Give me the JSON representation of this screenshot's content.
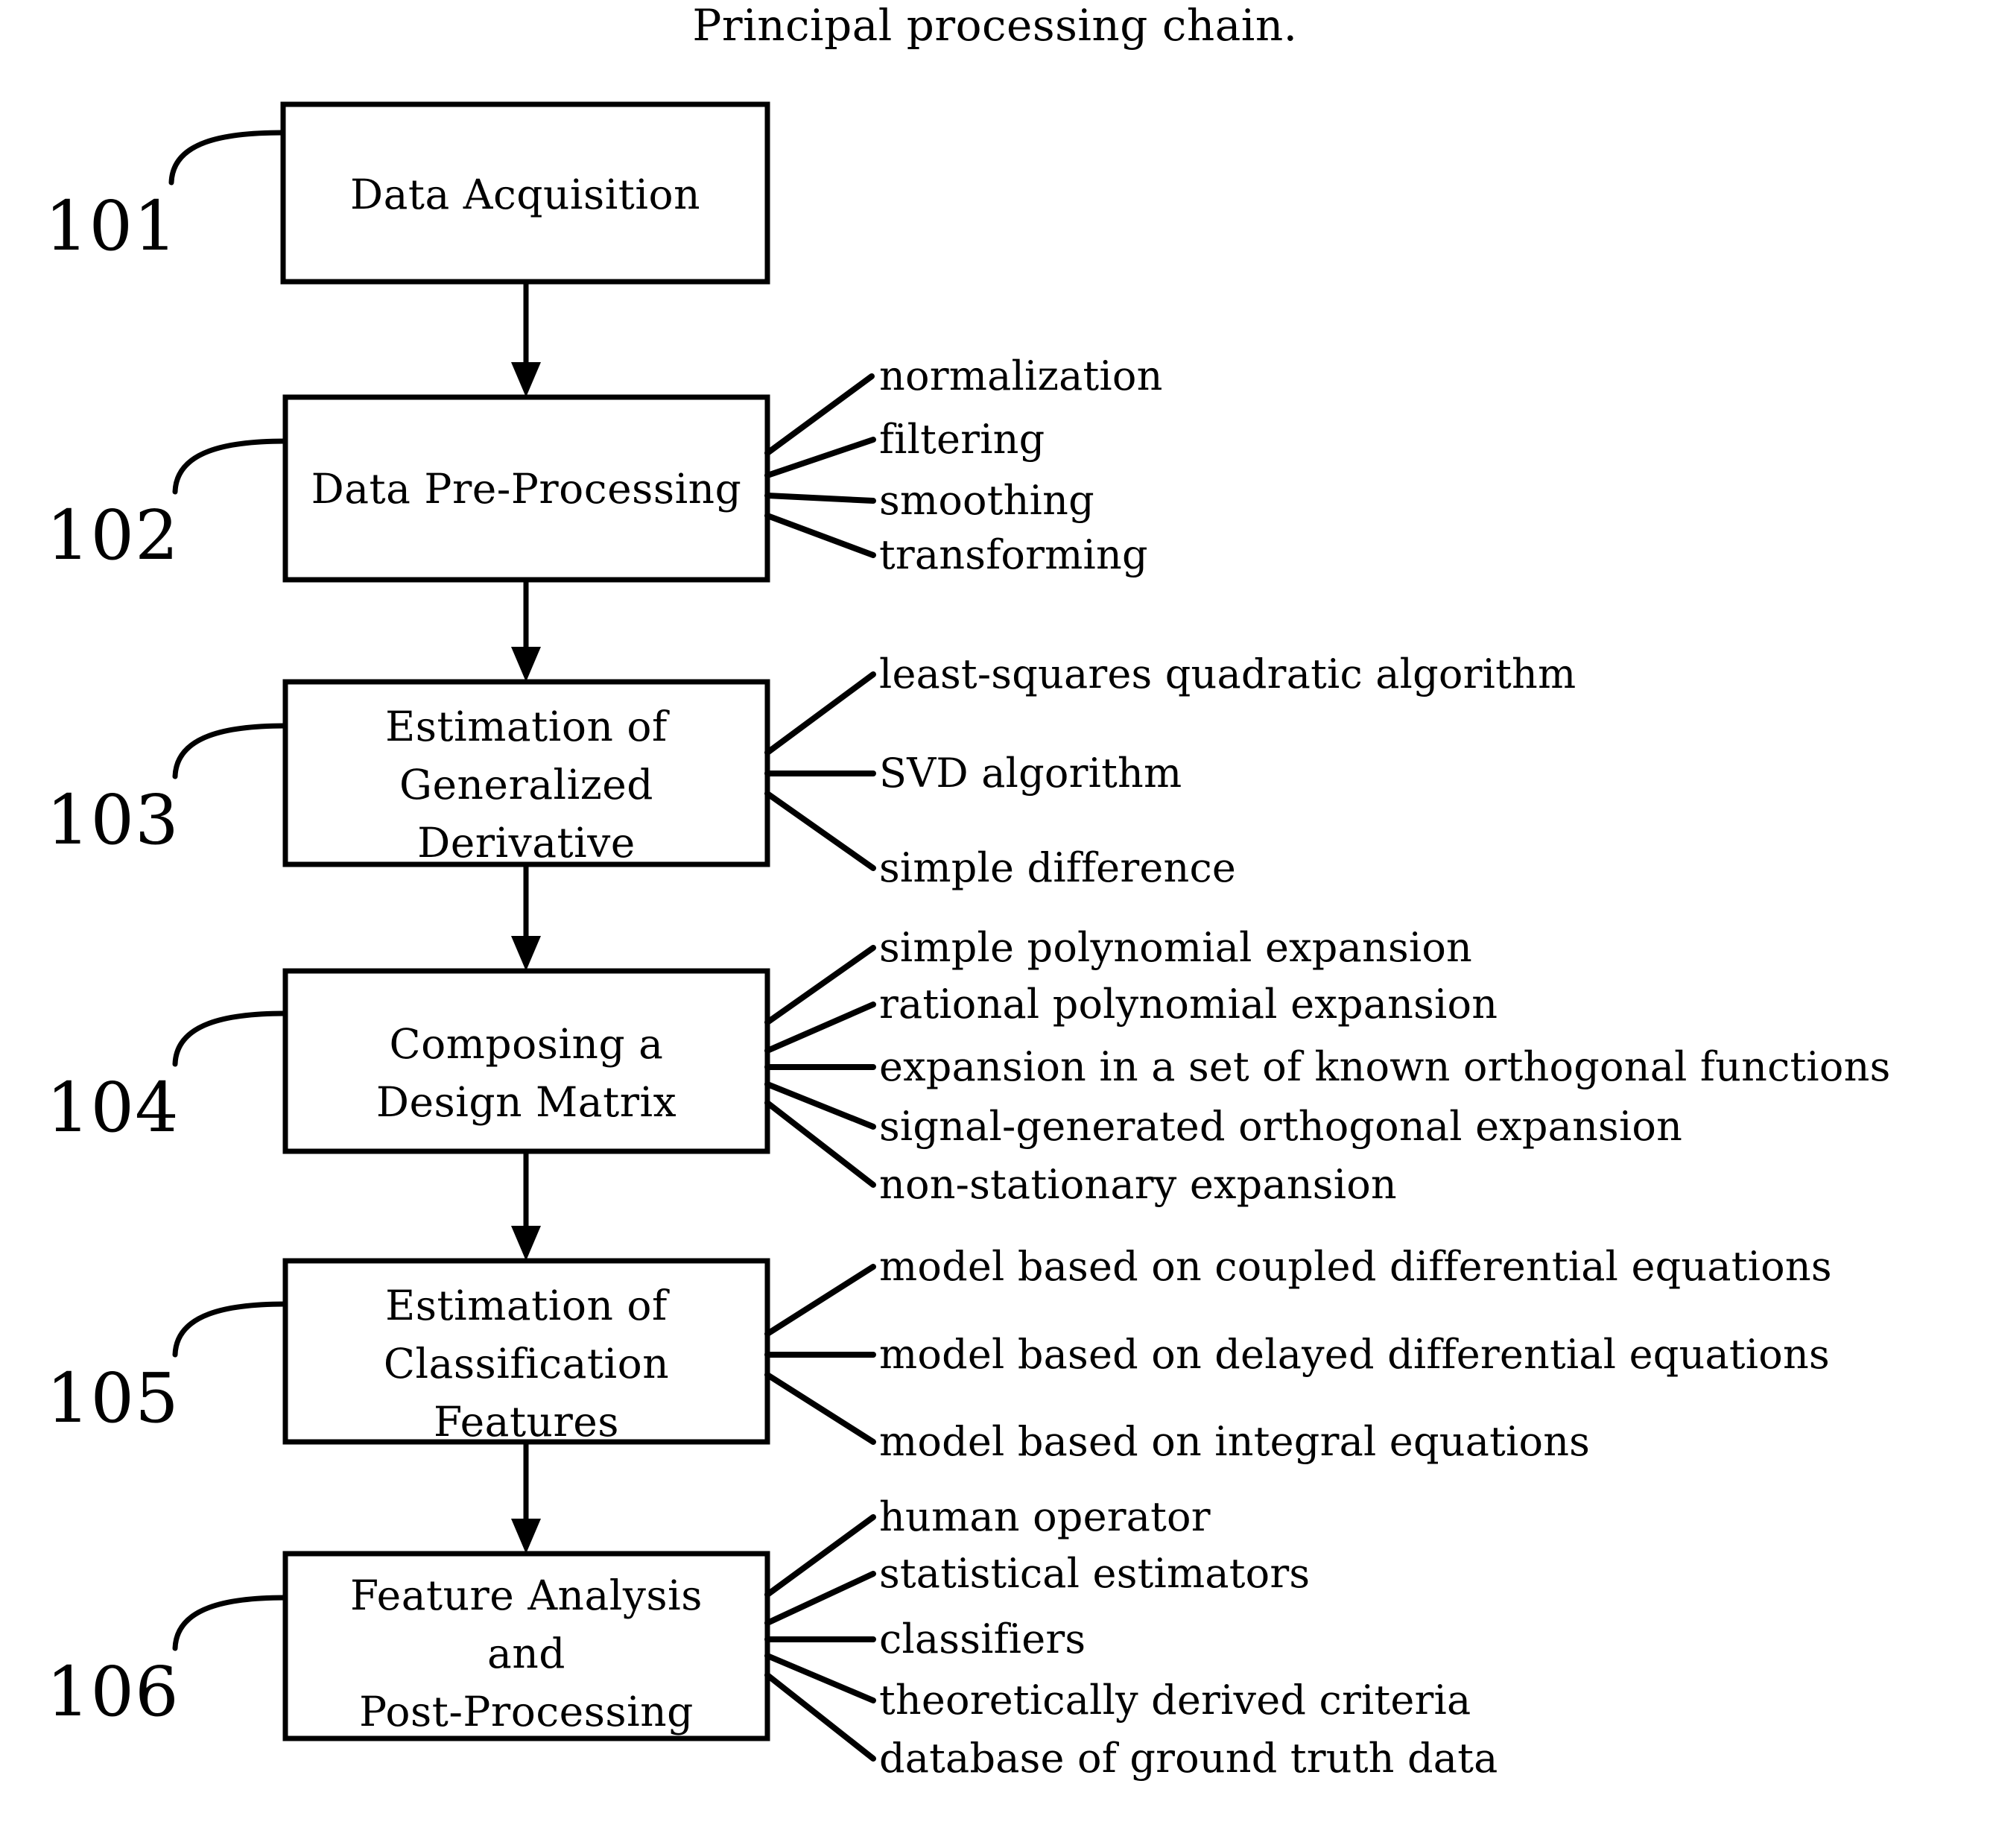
{
  "figure": {
    "title": "Principal processing chain."
  },
  "steps": [
    {
      "ref": "101",
      "label": "Data Acquisition",
      "annotations": []
    },
    {
      "ref": "102",
      "label": "Data Pre-Processing",
      "annotations": [
        "normalization",
        "filtering",
        "smoothing",
        "transforming"
      ]
    },
    {
      "ref": "103",
      "label": "Estimation of\nGeneralized\nDerivative",
      "annotations": [
        "least-squares quadratic algorithm",
        "SVD algorithm",
        "simple difference"
      ]
    },
    {
      "ref": "104",
      "label": "Composing a\nDesign Matrix",
      "annotations": [
        "simple polynomial expansion",
        "rational polynomial expansion",
        "expansion in a set of known orthogonal functions",
        "signal-generated orthogonal expansion",
        "non-stationary expansion"
      ]
    },
    {
      "ref": "105",
      "label": "Estimation of\nClassification\nFeatures",
      "annotations": [
        "model based on coupled differential equations",
        "model based on delayed differential equations",
        "model based on integral equations"
      ]
    },
    {
      "ref": "106",
      "label": "Feature Analysis\nand\nPost-Processing",
      "annotations": [
        "human operator",
        "statistical estimators",
        "classifiers",
        "theoretically derived criteria",
        "database of ground truth data"
      ]
    }
  ],
  "colors": {
    "ink": "#000000",
    "paper": "#ffffff"
  }
}
